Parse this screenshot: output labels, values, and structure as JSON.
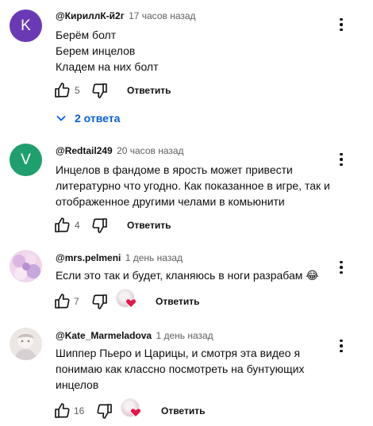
{
  "comments": [
    {
      "avatar_letter": "K",
      "avatar_color": "#6a3ab5",
      "author": "@КириллК-й2г",
      "time": "17 часов назад",
      "text": "Берём болт\nБерем инцелов\nКладем на них болт",
      "likes": "5",
      "reply_label": "Ответить"
    },
    {
      "avatar_letter": "V",
      "avatar_color": "#1f9e6e",
      "author": "@Redtail249",
      "time": "20 часов назад",
      "text": "Инцелов в фандоме в ярость может привести литературно что угодно. Как показанное в игре, так и отображенное другими челами в комьюнити",
      "likes": "4",
      "reply_label": "Ответить"
    },
    {
      "avatar_letter": "",
      "avatar_color": "#e8c9e6",
      "author": "@mrs.pelmeni",
      "time": "1 день назад",
      "text": "Если это так и будет, кланяюсь в ноги разрабам 😂",
      "likes": "7",
      "reply_label": "Ответить"
    },
    {
      "avatar_letter": "",
      "avatar_color": "#e6e1e3",
      "author": "@Kate_Marmeladova",
      "time": "1 день назад",
      "text": "Шиппер Пьеро  и Царицы, и смотря эта видео я понимаю как  классно посмотреть на бунтующих инцелов",
      "likes": "16",
      "reply_label": "Ответить"
    }
  ],
  "replies_toggle": {
    "label": "2 ответа",
    "color": "#065fd4",
    "icon": "chevron-down-icon"
  },
  "colors": {
    "heart": "#e5164a",
    "muted": "#606060",
    "text": "#0f0f0f"
  }
}
